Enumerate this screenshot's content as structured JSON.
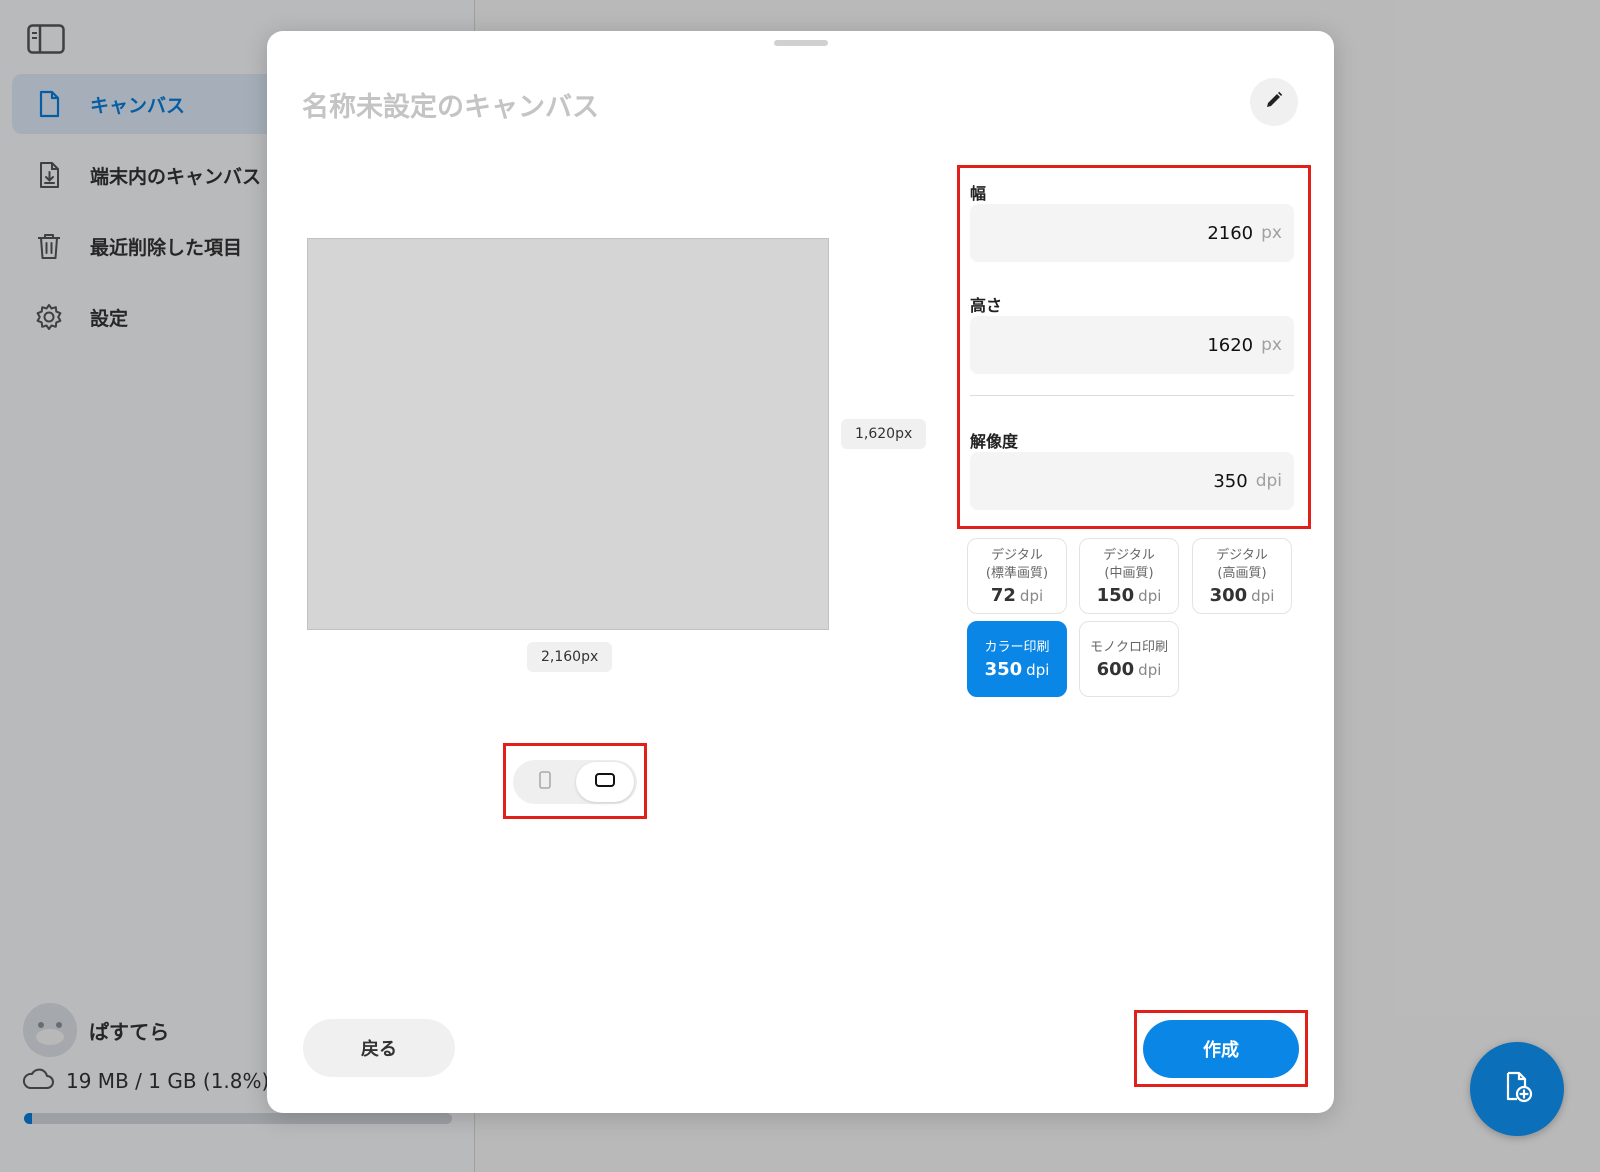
{
  "sidebar": {
    "items": [
      {
        "label": "キャンバス",
        "icon": "document-icon",
        "active": true
      },
      {
        "label": "端末内のキャンバス",
        "icon": "device-document-icon",
        "active": false
      },
      {
        "label": "最近削除した項目",
        "icon": "trash-icon",
        "active": false
      },
      {
        "label": "設定",
        "icon": "gear-icon",
        "active": false
      }
    ],
    "user": {
      "name": "ぱすてら"
    },
    "storage": {
      "text": "19 MB / 1 GB (1.8%)",
      "fraction": 0.018
    }
  },
  "modal": {
    "title": "名称未設定のキャンバス",
    "preview": {
      "height_label": "1,620px",
      "width_label": "2,160px"
    },
    "orientation": {
      "options": [
        "portrait",
        "landscape"
      ],
      "selected": "landscape"
    },
    "fields": {
      "width": {
        "label": "幅",
        "value": "2160",
        "unit": "px"
      },
      "height": {
        "label": "高さ",
        "value": "1620",
        "unit": "px"
      },
      "resolution": {
        "label": "解像度",
        "value": "350",
        "unit": "dpi"
      }
    },
    "presets": [
      {
        "line1": "デジタル",
        "line2": "(標準画質)",
        "value": "72",
        "unit": "dpi",
        "selected": false
      },
      {
        "line1": "デジタル",
        "line2": "(中画質)",
        "value": "150",
        "unit": "dpi",
        "selected": false
      },
      {
        "line1": "デジタル",
        "line2": "(高画質)",
        "value": "300",
        "unit": "dpi",
        "selected": false
      },
      {
        "line1": "カラー印刷",
        "line2": "",
        "value": "350",
        "unit": "dpi",
        "selected": true
      },
      {
        "line1": "モノクロ印刷",
        "line2": "",
        "value": "600",
        "unit": "dpi",
        "selected": false
      }
    ],
    "back_label": "戻る",
    "create_label": "作成"
  },
  "colors": {
    "accent": "#0a86e6",
    "highlight": "#e0201b",
    "fab": "#0b6fba"
  }
}
